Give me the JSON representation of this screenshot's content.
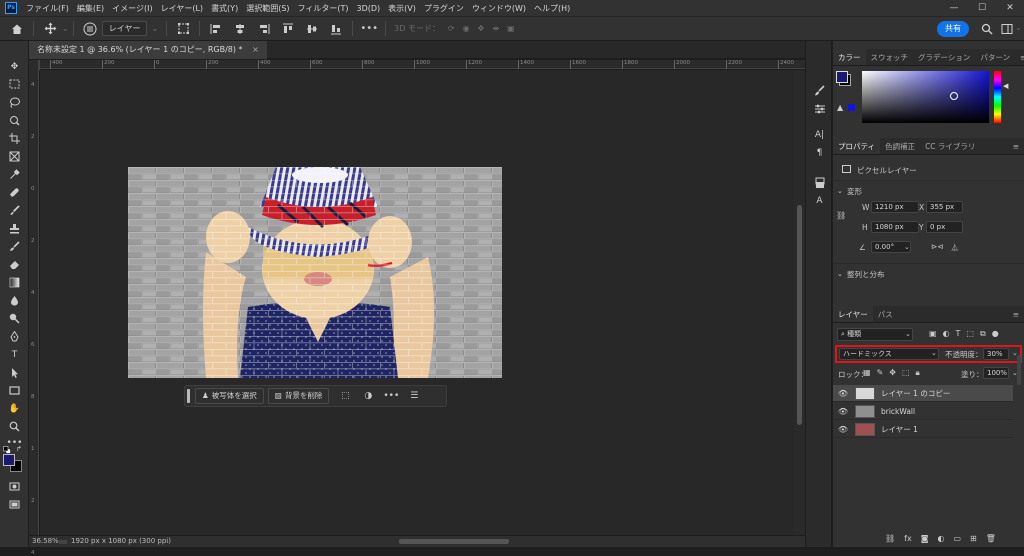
{
  "app": {
    "logo_text": "Ps"
  },
  "menu": {
    "items": [
      "ファイル(F)",
      "編集(E)",
      "イメージ(I)",
      "レイヤー(L)",
      "書式(Y)",
      "選択範囲(S)",
      "フィルター(T)",
      "3D(D)",
      "表示(V)",
      "プラグイン",
      "ウィンドウ(W)",
      "ヘルプ(H)"
    ]
  },
  "window_controls": {
    "minimize": "—",
    "maximize": "☐",
    "close": "✕"
  },
  "options_bar": {
    "layer_dropdown": "レイヤー",
    "mode_3d": "3D モード：",
    "more": "•••",
    "share_label": "共有"
  },
  "document": {
    "tab_title": "名称未設定 1 @ 36.6% (レイヤー 1 のコピー, RGB/8) *",
    "close_glyph": "×"
  },
  "ruler": {
    "top_ticks": [
      "400",
      "200",
      "0",
      "200",
      "400",
      "600",
      "800",
      "1000",
      "1200",
      "1400",
      "1600",
      "1800",
      "2000",
      "2200",
      "2400"
    ],
    "left_ticks": [
      "4",
      "2",
      "0",
      "2",
      "4",
      "6",
      "8",
      "1",
      "2",
      "4"
    ]
  },
  "context_bar": {
    "select_subject": "被写体を選択",
    "remove_bg": "背景を削除",
    "more": "•••"
  },
  "status": {
    "zoom": "36.58%",
    "doc_info": "1920 px x 1080 px (300 ppi)"
  },
  "color_panel": {
    "tabs": [
      "カラー",
      "スウォッチ",
      "グラデーション",
      "パターン"
    ],
    "fg_color": "#1a1a6e",
    "bg_color": "#000000",
    "hue_color": "#1414d4"
  },
  "properties_panel": {
    "tabs": [
      "プロパティ",
      "色調補正",
      "CC ライブラリ"
    ],
    "kind": "ピクセルレイヤー",
    "transform_title": "変形",
    "w_label": "W",
    "w_value": "1210 px",
    "x_label": "X",
    "x_value": "355 px",
    "h_label": "H",
    "h_value": "1080 px",
    "y_label": "Y",
    "y_value": "0 px",
    "angle_value": "0.00°",
    "align_title": "整列と分布"
  },
  "layers_panel": {
    "tabs": [
      "レイヤー",
      "パス"
    ],
    "filter_label": "種類",
    "blend_mode": "ハードミックス",
    "opacity_label": "不透明度：",
    "opacity_value": "30%",
    "lock_label": "ロック：",
    "fill_label": "塗り：",
    "fill_value": "100%",
    "layers": [
      {
        "name": "レイヤー 1 のコピー",
        "selected": true
      },
      {
        "name": "brickWall",
        "selected": false
      },
      {
        "name": "レイヤー 1",
        "selected": false
      }
    ],
    "highlight_color": "#e0141e"
  }
}
